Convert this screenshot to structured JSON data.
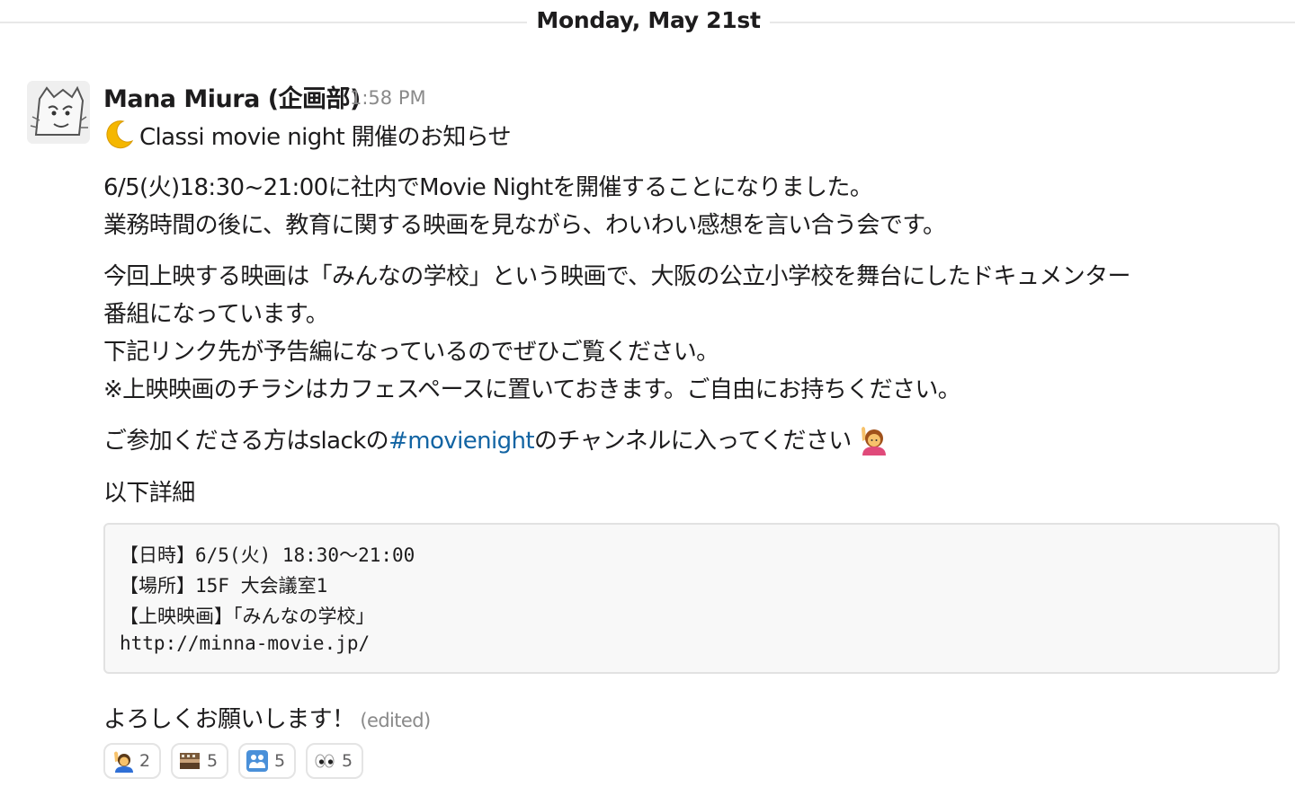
{
  "divider": {
    "date": "Monday, May 21st"
  },
  "message": {
    "sender": "Mana Miura (企画部)",
    "time": "1:58 PM",
    "title": "Classi movie night 開催のお知らせ",
    "p1_line1": "6/5(火)18:30~21:00に社内でMovie Nightを開催することになりました。",
    "p1_line2": "業務時間の後に、教育に関する映画を見ながら、わいわい感想を言い合う会です。",
    "p2_line1": "今回上映する映画は「みんなの学校」という映画で、大阪の公立小学校を舞台にしたドキュメンター",
    "p2_line2": "番組になっています。",
    "p2_line3": "下記リンク先が予告編になっているのでぜひご覧ください。",
    "p2_line4": "※上映映画のチラシはカフェスペースに置いておきます。ご自由にお持ちください。",
    "p3_before": "ご参加くださる方はslackの",
    "p3_channel": "#movienight",
    "p3_after": "のチャンネルに入ってください",
    "details_label": "以下詳細",
    "code_lines": [
      "【日時】6/5(火) 18:30〜21:00",
      "【場所】15F 大会議室1",
      "【上映映画】「みんなの学校」",
      "http://minna-movie.jp/"
    ],
    "closing": "よろしくお願いします！",
    "edited": "(edited)"
  },
  "reactions": [
    {
      "icon": "raising-hand-icon",
      "count": "2"
    },
    {
      "icon": "film-icon",
      "count": "5"
    },
    {
      "icon": "people-icon",
      "count": "5"
    },
    {
      "icon": "eyes-icon",
      "count": "5"
    }
  ],
  "colors": {
    "link": "#1264a3",
    "text": "#1d1c1d",
    "muted": "#8a8a8a"
  }
}
